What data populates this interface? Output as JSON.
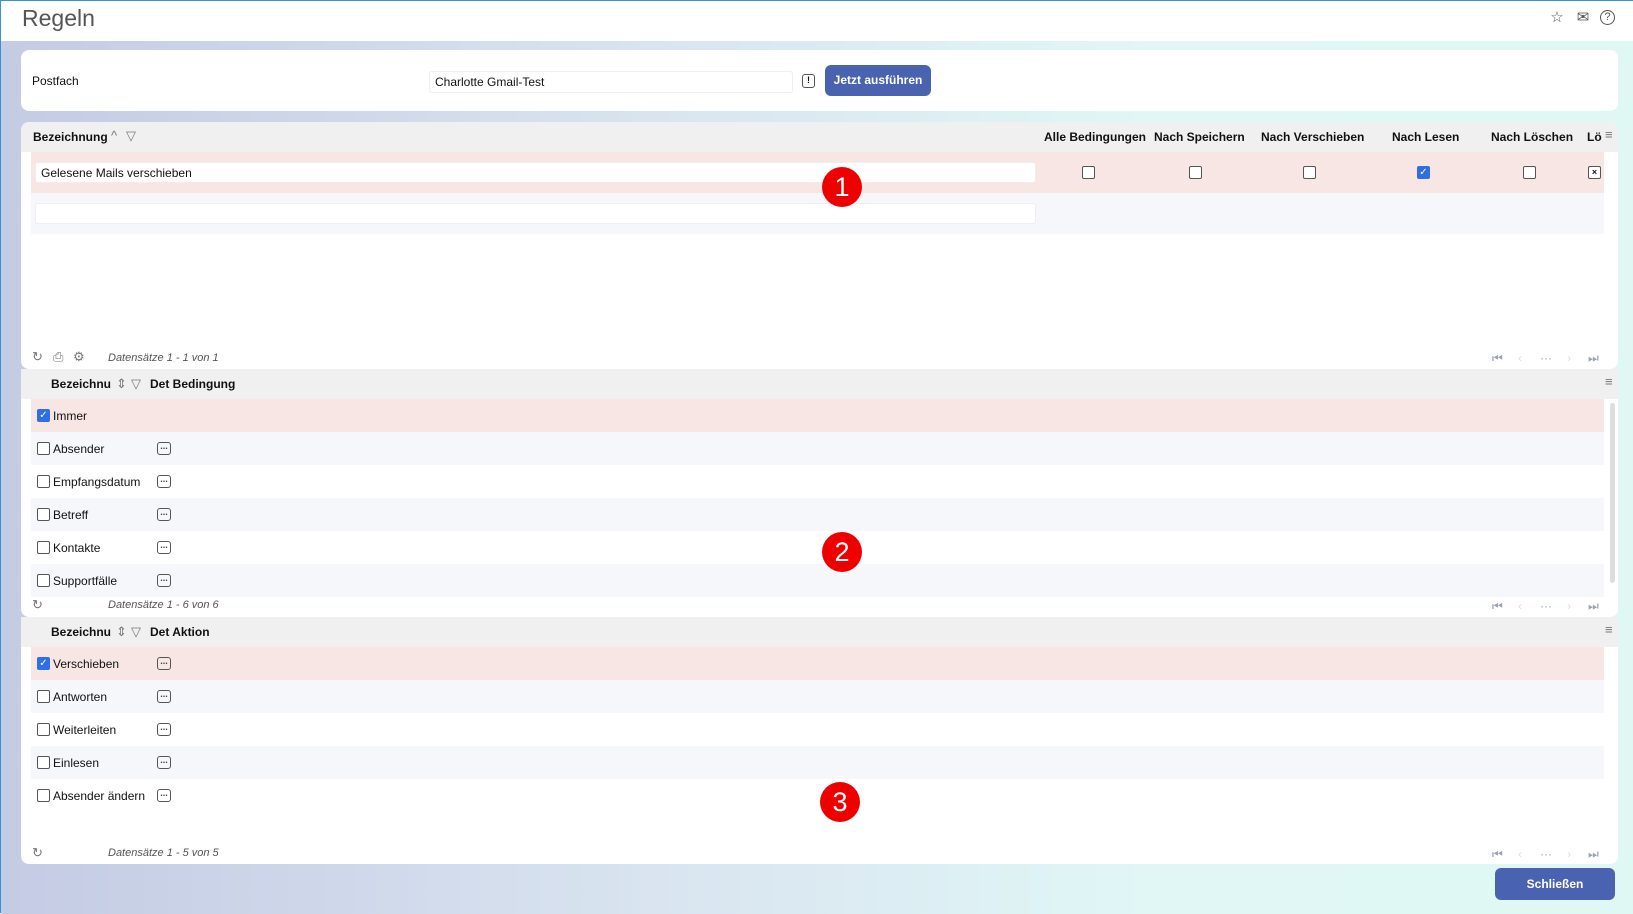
{
  "title": "Regeln",
  "header_icons": [
    "star-icon",
    "mail-icon",
    "help-icon"
  ],
  "postfach": {
    "label": "Postfach",
    "value": "Charlotte Gmail-Test",
    "run_button": "Jetzt ausführen"
  },
  "rules_grid": {
    "columns": [
      "Bezeichnung",
      "Alle Bedingungen",
      "Nach Speichern",
      "Nach Verschieben",
      "Nach Lesen",
      "Nach Löschen",
      "Lö"
    ],
    "rows": [
      {
        "name": "Gelesene Mails verschieben",
        "alle": false,
        "speichern": false,
        "verschieben": false,
        "lesen": true,
        "loeschen": false
      }
    ],
    "footer": "Datensätze 1 - 1 von 1"
  },
  "conditions_grid": {
    "columns": [
      "Bezeichnu",
      "Det Bedingung"
    ],
    "rows": [
      {
        "label": "Immer",
        "checked": true
      },
      {
        "label": "Absender",
        "checked": false
      },
      {
        "label": "Empfangsdatum",
        "checked": false
      },
      {
        "label": "Betreff",
        "checked": false
      },
      {
        "label": "Kontakte",
        "checked": false
      },
      {
        "label": "Supportfälle",
        "checked": false
      }
    ],
    "footer": "Datensätze 1 - 6 von 6"
  },
  "actions_grid": {
    "columns": [
      "Bezeichnu",
      "Det Aktion"
    ],
    "rows": [
      {
        "label": "Verschieben",
        "checked": true
      },
      {
        "label": "Antworten",
        "checked": false
      },
      {
        "label": "Weiterleiten",
        "checked": false
      },
      {
        "label": "Einlesen",
        "checked": false
      },
      {
        "label": "Absender ändern",
        "checked": false
      }
    ],
    "footer": "Datensätze 1 - 5 von 5"
  },
  "annotations": [
    "1",
    "2",
    "3"
  ],
  "close_button": "Schließen",
  "colors": {
    "accent": "#4a63b0",
    "selected_row": "#f8e6e4",
    "annotation": "#e00000"
  }
}
